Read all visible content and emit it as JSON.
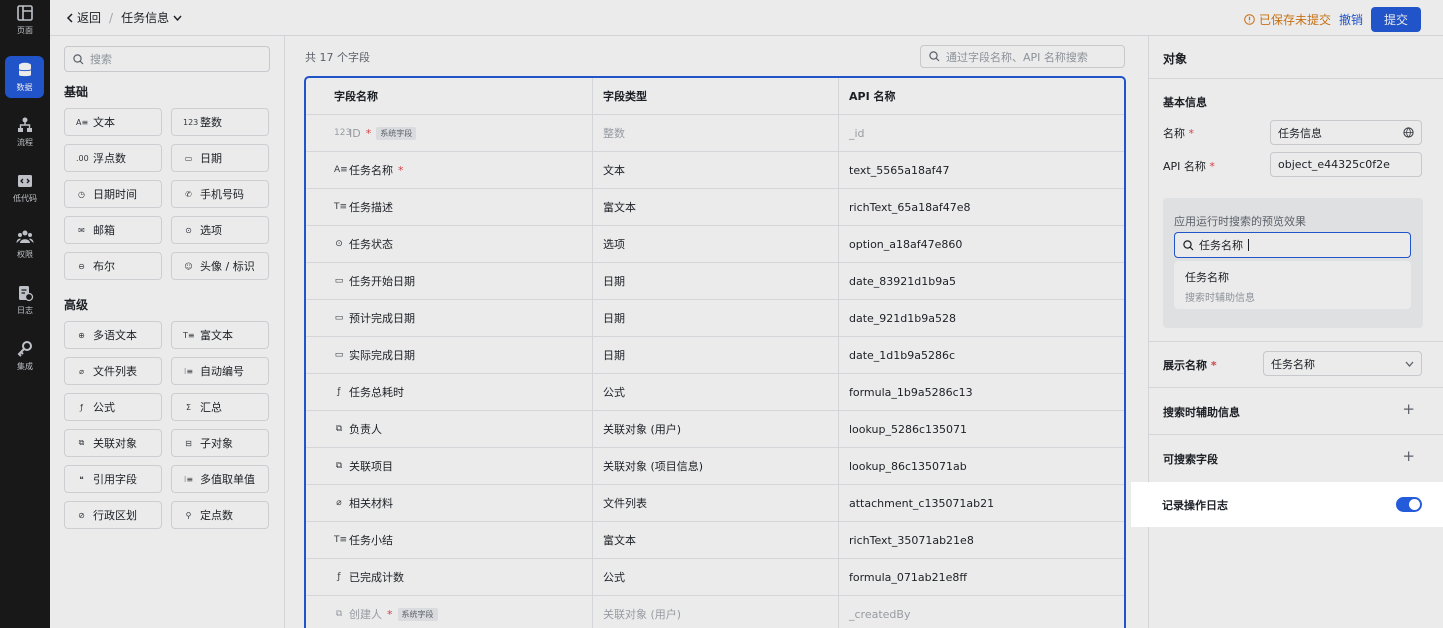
{
  "rail": {
    "items": [
      {
        "label": "页面",
        "icon": "layout-icon"
      },
      {
        "label": "数据",
        "icon": "database-icon",
        "active": true
      },
      {
        "label": "流程",
        "icon": "flow-icon"
      },
      {
        "label": "低代码",
        "icon": "code-icon"
      },
      {
        "label": "权限",
        "icon": "people-icon"
      },
      {
        "label": "日志",
        "icon": "log-icon"
      },
      {
        "label": "集成",
        "icon": "key-icon"
      }
    ]
  },
  "topbar": {
    "back_label": "返回",
    "breadcrumb": "任务信息",
    "unsaved": "已保存未提交",
    "revoke": "撤销",
    "submit": "提交"
  },
  "palette": {
    "search_placeholder": "搜索",
    "basic_title": "基础",
    "basic": [
      {
        "icon": "A≡",
        "label": "文本"
      },
      {
        "icon": "123",
        "label": "整数"
      },
      {
        "icon": ".00",
        "label": "浮点数"
      },
      {
        "icon": "▭",
        "label": "日期"
      },
      {
        "icon": "◷",
        "label": "日期时间"
      },
      {
        "icon": "✆",
        "label": "手机号码"
      },
      {
        "icon": "✉",
        "label": "邮箱"
      },
      {
        "icon": "⊙",
        "label": "选项"
      },
      {
        "icon": "⊖",
        "label": "布尔"
      },
      {
        "icon": "☺",
        "label": "头像 / 标识"
      }
    ],
    "advanced_title": "高级",
    "advanced": [
      {
        "icon": "⊕",
        "label": "多语文本"
      },
      {
        "icon": "T≡",
        "label": "富文本"
      },
      {
        "icon": "⌀",
        "label": "文件列表"
      },
      {
        "icon": "⁝≡",
        "label": "自动编号"
      },
      {
        "icon": "ƒ",
        "label": "公式"
      },
      {
        "icon": "Σ",
        "label": "汇总"
      },
      {
        "icon": "⧉",
        "label": "关联对象"
      },
      {
        "icon": "⊟",
        "label": "子对象"
      },
      {
        "icon": "❝",
        "label": "引用字段"
      },
      {
        "icon": "⁝≡",
        "label": "多值取单值"
      },
      {
        "icon": "⊘",
        "label": "行政区划"
      },
      {
        "icon": "⚲",
        "label": "定点数"
      }
    ]
  },
  "table": {
    "count_label": "共 17 个字段",
    "search_placeholder": "通过字段名称、API 名称搜索",
    "headers": [
      "字段名称",
      "字段类型",
      "API 名称"
    ],
    "rows": [
      {
        "icon": "123",
        "name": "ID",
        "required": true,
        "tag": "系统字段",
        "type": "整数",
        "api": "_id",
        "system": true
      },
      {
        "icon": "A≡",
        "name": "任务名称",
        "required": true,
        "tag": "",
        "type": "文本",
        "api": "text_5565a18af47",
        "system": false
      },
      {
        "icon": "T≡",
        "name": "任务描述",
        "required": false,
        "tag": "",
        "type": "富文本",
        "api": "richText_65a18af47e8",
        "system": false
      },
      {
        "icon": "⊙",
        "name": "任务状态",
        "required": false,
        "tag": "",
        "type": "选项",
        "api": "option_a18af47e860",
        "system": false
      },
      {
        "icon": "▭",
        "name": "任务开始日期",
        "required": false,
        "tag": "",
        "type": "日期",
        "api": "date_83921d1b9a5",
        "system": false
      },
      {
        "icon": "▭",
        "name": "预计完成日期",
        "required": false,
        "tag": "",
        "type": "日期",
        "api": "date_921d1b9a528",
        "system": false
      },
      {
        "icon": "▭",
        "name": "实际完成日期",
        "required": false,
        "tag": "",
        "type": "日期",
        "api": "date_1d1b9a5286c",
        "system": false
      },
      {
        "icon": "ƒ",
        "name": "任务总耗时",
        "required": false,
        "tag": "",
        "type": "公式",
        "api": "formula_1b9a5286c13",
        "system": false
      },
      {
        "icon": "⧉",
        "name": "负责人",
        "required": false,
        "tag": "",
        "type": "关联对象 (用户)",
        "api": "lookup_5286c135071",
        "system": false
      },
      {
        "icon": "⧉",
        "name": "关联项目",
        "required": false,
        "tag": "",
        "type": "关联对象 (项目信息)",
        "api": "lookup_86c135071ab",
        "system": false
      },
      {
        "icon": "⌀",
        "name": "相关材料",
        "required": false,
        "tag": "",
        "type": "文件列表",
        "api": "attachment_c135071ab21",
        "system": false
      },
      {
        "icon": "T≡",
        "name": "任务小结",
        "required": false,
        "tag": "",
        "type": "富文本",
        "api": "richText_35071ab21e8",
        "system": false
      },
      {
        "icon": "ƒ",
        "name": "已完成计数",
        "required": false,
        "tag": "",
        "type": "公式",
        "api": "formula_071ab21e8ff",
        "system": false
      },
      {
        "icon": "⧉",
        "name": "创建人",
        "required": true,
        "tag": "系统字段",
        "type": "关联对象 (用户)",
        "api": "_createdBy",
        "system": true
      }
    ]
  },
  "right": {
    "object_title": "对象",
    "basic_info": "基本信息",
    "name_label": "名称",
    "name_value": "任务信息",
    "api_label": "API 名称",
    "api_value": "object_e44325c0f2e",
    "preview_title": "应用运行时搜索的预览效果",
    "preview_input": "任务名称",
    "preview_item": "任务名称",
    "preview_sub": "搜索时辅助信息",
    "display_label": "展示名称",
    "display_value": "任务名称",
    "search_aux": "搜索时辅助信息",
    "searchable": "可搜索字段",
    "log_label": "记录操作日志",
    "log_enabled": true,
    "accent": "#245bdb"
  }
}
